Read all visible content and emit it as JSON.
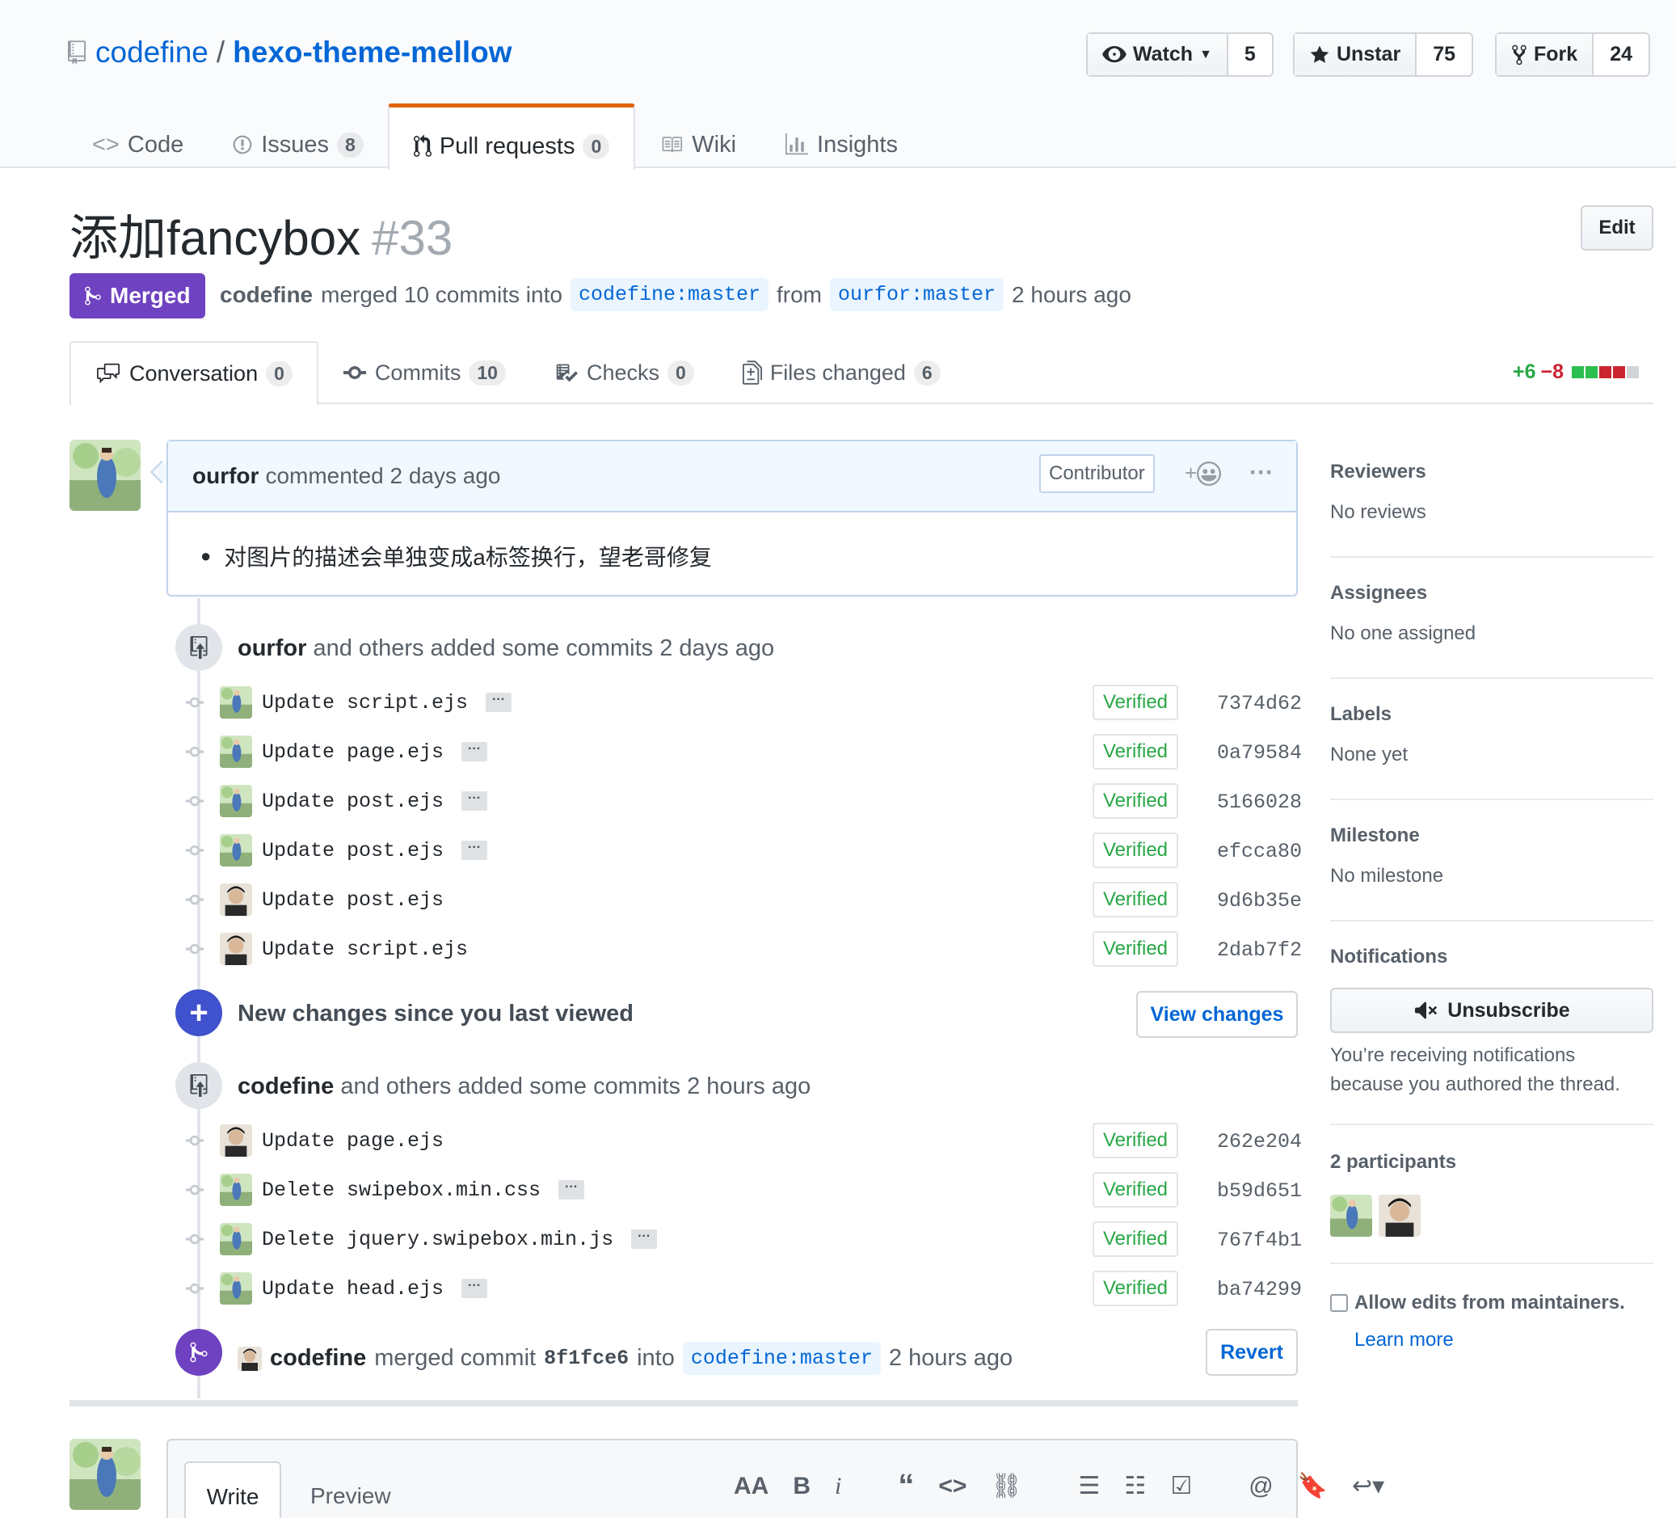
{
  "repo": {
    "owner": "codefine",
    "separator": "/",
    "name": "hexo-theme-mellow"
  },
  "actions": {
    "watch_label": "Watch",
    "watch_count": "5",
    "star_label": "Unstar",
    "star_count": "75",
    "fork_label": "Fork",
    "fork_count": "24"
  },
  "reponav": [
    {
      "label": "Code",
      "icon": "code-icon"
    },
    {
      "label": "Issues",
      "count": "8",
      "icon": "issue-opened-icon"
    },
    {
      "label": "Pull requests",
      "count": "0",
      "icon": "git-pull-request-icon"
    },
    {
      "label": "Wiki",
      "icon": "book-icon"
    },
    {
      "label": "Insights",
      "icon": "graph-icon"
    }
  ],
  "pr": {
    "title": "添加fancybox",
    "number": "#33",
    "edit_label": "Edit",
    "state": "Merged",
    "author": "codefine",
    "merged_text": "merged 10 commits into",
    "base": "codefine:master",
    "from_text": "from",
    "head": "ourfor:master",
    "time": "2 hours ago"
  },
  "tabs": [
    {
      "label": "Conversation",
      "count": "0",
      "icon": "comment-discussion-icon"
    },
    {
      "label": "Commits",
      "count": "10",
      "icon": "git-commit-icon"
    },
    {
      "label": "Checks",
      "count": "0",
      "icon": "checklist-icon"
    },
    {
      "label": "Files changed",
      "count": "6",
      "icon": "file-diff-icon"
    }
  ],
  "diffstat": {
    "additions": "+6",
    "deletions": "−8"
  },
  "comment": {
    "author": "ourfor",
    "action": "commented 2 days ago",
    "association": "Contributor",
    "body": "对图片的描述会单独变成a标签换行，望老哥修复"
  },
  "commit_groups": [
    {
      "author": "ourfor",
      "text": "and others added some commits 2 days ago",
      "commits": [
        {
          "message": "Update script.ejs",
          "verified": "Verified",
          "sha": "7374d62",
          "avatar": "ourfor",
          "has_more": true
        },
        {
          "message": "Update page.ejs",
          "verified": "Verified",
          "sha": "0a79584",
          "avatar": "ourfor",
          "has_more": true
        },
        {
          "message": "Update post.ejs",
          "verified": "Verified",
          "sha": "5166028",
          "avatar": "ourfor",
          "has_more": true
        },
        {
          "message": "Update post.ejs",
          "verified": "Verified",
          "sha": "efcca80",
          "avatar": "ourfor",
          "has_more": true
        },
        {
          "message": "Update post.ejs",
          "verified": "Verified",
          "sha": "9d6b35e",
          "avatar": "codefine",
          "has_more": false
        },
        {
          "message": "Update script.ejs",
          "verified": "Verified",
          "sha": "2dab7f2",
          "avatar": "codefine",
          "has_more": false
        }
      ]
    },
    {
      "author": "codefine",
      "text": "and others added some commits 2 hours ago",
      "commits": [
        {
          "message": "Update page.ejs",
          "verified": "Verified",
          "sha": "262e204",
          "avatar": "codefine",
          "has_more": false
        },
        {
          "message": "Delete swipebox.min.css",
          "verified": "Verified",
          "sha": "b59d651",
          "avatar": "ourfor",
          "has_more": true
        },
        {
          "message": "Delete jquery.swipebox.min.js",
          "verified": "Verified",
          "sha": "767f4b1",
          "avatar": "ourfor",
          "has_more": true
        },
        {
          "message": "Update head.ejs",
          "verified": "Verified",
          "sha": "ba74299",
          "avatar": "ourfor",
          "has_more": true
        }
      ]
    }
  ],
  "new_changes": {
    "text": "New changes since you last viewed",
    "button": "View changes"
  },
  "merge_event": {
    "author": "codefine",
    "text1": "merged commit",
    "sha": "8f1fce6",
    "text2": "into",
    "branch": "codefine:master",
    "time": "2 hours ago",
    "revert_label": "Revert"
  },
  "editor": {
    "write_tab": "Write",
    "preview_tab": "Preview"
  },
  "sidebar": {
    "reviewers": {
      "title": "Reviewers",
      "value": "No reviews"
    },
    "assignees": {
      "title": "Assignees",
      "value": "No one assigned"
    },
    "labels": {
      "title": "Labels",
      "value": "None yet"
    },
    "milestone": {
      "title": "Milestone",
      "value": "No milestone"
    },
    "notifications": {
      "title": "Notifications",
      "button": "Unsubscribe",
      "reason": "You’re receiving notifications because you authored the thread."
    },
    "participants": {
      "title": "2 participants"
    },
    "maintainer_edits": {
      "label": "Allow edits from maintainers.",
      "learn_more": "Learn more"
    }
  },
  "colors": {
    "link": "#0366d6",
    "merged": "#6f42c1",
    "verified": "#28a745",
    "additions": "#28a745",
    "deletions": "#cb2431",
    "new_changes": "#3f51cc",
    "tab_accent": "#e36209"
  }
}
